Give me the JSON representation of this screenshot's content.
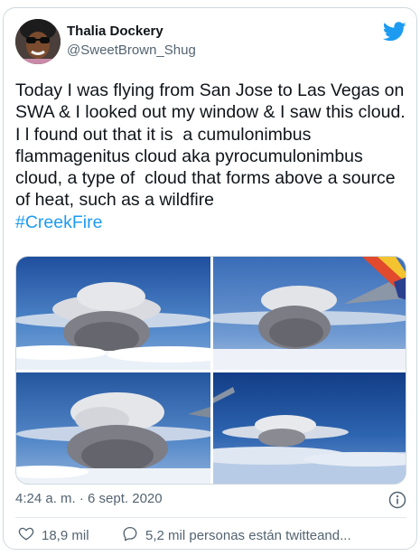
{
  "user": {
    "name": "Thalia Dockery",
    "handle": "@SweetBrown_Shug"
  },
  "tweet": {
    "text": "Today I was flying from San Jose to Las Vegas on SWA & I looked out my window & I saw this cloud. I l found out that it is  a cumulonimbus flammagenitus cloud aka pyrocumulonimbus cloud, a type of  cloud that forms above a source of heat, such as a wildfire",
    "hashtag": "#CreekFire"
  },
  "media": {
    "photos": [
      {
        "subject": "pyrocumulonimbus-cloud-photo-1"
      },
      {
        "subject": "pyrocumulonimbus-cloud-photo-2-with-wing"
      },
      {
        "subject": "pyrocumulonimbus-cloud-photo-3"
      },
      {
        "subject": "pyrocumulonimbus-cloud-photo-4-with-wing"
      }
    ]
  },
  "meta": {
    "timestamp": "4:24 a. m. · 6 sept. 2020"
  },
  "actions": {
    "likes": "18,9 mil",
    "conversation": "5,2 mil personas están twitteand..."
  },
  "colors": {
    "accent": "#1d9bf0",
    "text": "#0f1419",
    "muted": "#536471",
    "border": "#cfd9de"
  },
  "icons": [
    "twitter-bird-icon",
    "info-icon",
    "heart-icon",
    "reply-bubble-icon"
  ]
}
